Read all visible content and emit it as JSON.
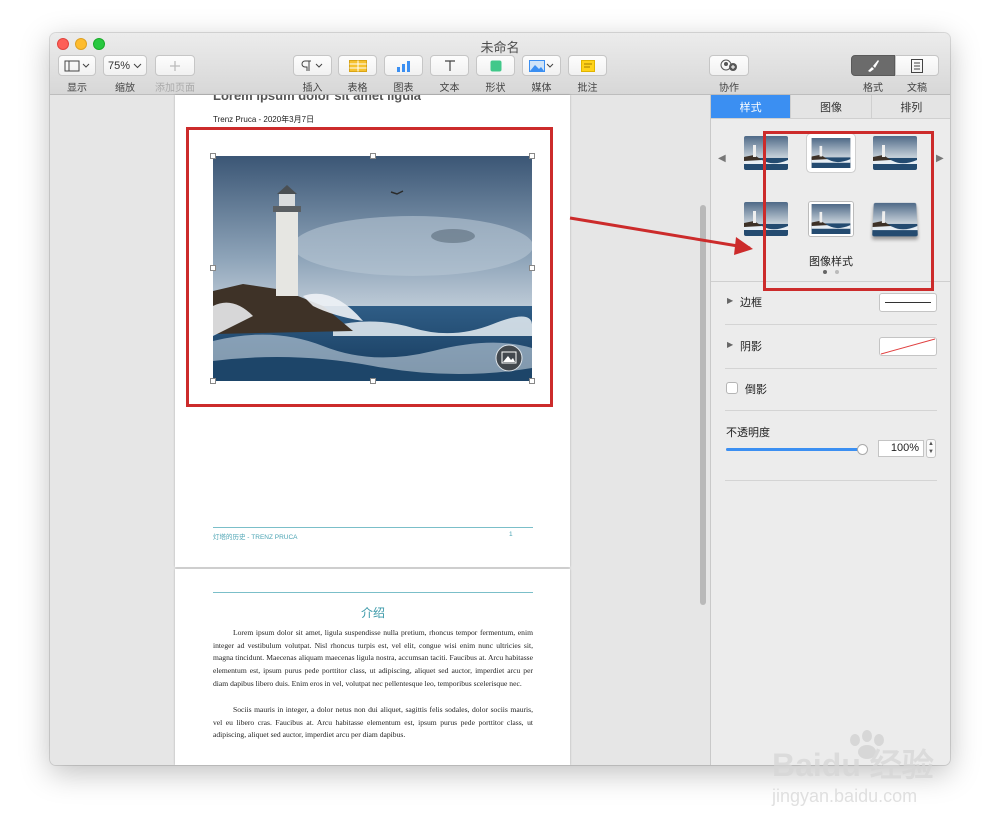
{
  "window": {
    "title": "未命名"
  },
  "toolbar": {
    "view_label": "显示",
    "zoom_value": "75%",
    "zoom_label": "缩放",
    "add_page_label": "添加页面",
    "insert_label": "插入",
    "table_label": "表格",
    "chart_label": "图表",
    "text_label": "文本",
    "shape_label": "形状",
    "media_label": "媒体",
    "comment_label": "批注",
    "collaborate_label": "协作",
    "format_label": "格式",
    "document_label": "文稿"
  },
  "document": {
    "heading": "Lorem ipsum dolor sit amet ligula",
    "byline": "Trenz Pruca - 2020年3月7日",
    "footer_left": "灯塔的历史 - TRENZ PRUCA",
    "footer_page": "1",
    "section_title": "介绍",
    "para1": "Lorem ipsum dolor sit amet, ligula suspendisse nulla pretium, rhoncus tempor fermentum, enim integer ad vestibulum volutpat. Nisl rhoncus turpis est, vel elit, congue wisi enim nunc ultricies sit, magna tincidunt. Maecenas aliquam maecenas ligula nostra, accumsan taciti. Faucibus at. Arcu habitasse elementum est, ipsum purus pede porttitor class, ut adipiscing, aliquet sed auctor, imperdiet arcu per diam dapibus libero duis. Enim eros in vel, volutpat nec pellentesque leo, temporibus scelerisque nec.",
    "para2": "Sociis mauris in integer, a dolor netus non dui aliquet, sagittis felis sodales, dolor sociis mauris, vel eu libero cras. Faucibus at. Arcu habitasse elementum est, ipsum purus pede porttitor class, ut adipiscing, aliquet sed auctor, imperdiet arcu per diam dapibus."
  },
  "sidebar": {
    "tabs": [
      {
        "label": "样式",
        "active": true
      },
      {
        "label": "图像",
        "active": false
      },
      {
        "label": "排列",
        "active": false
      }
    ],
    "styles_caption": "图像样式",
    "border_label": "边框",
    "shadow_label": "阴影",
    "reflection_label": "倒影",
    "opacity_label": "不透明度",
    "opacity_value": "100%",
    "opacity_level": 1.0
  },
  "watermark": {
    "brand": "Baidu 经验",
    "url": "jingyan.baidu.com"
  },
  "colors": {
    "accent": "#3b8ff2",
    "annotation": "#cc2b2b",
    "footer": "#4aa3b3"
  }
}
